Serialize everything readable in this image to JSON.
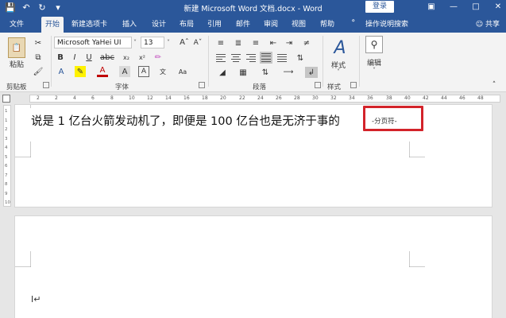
{
  "titlebar": {
    "title": "新建 Microsoft Word 文档.docx - Word",
    "login_label": "登录",
    "qat_icons": [
      "save-icon",
      "undo-icon",
      "redo-icon",
      "customize-icon"
    ],
    "window_buttons": [
      "ribbon-display-icon",
      "minimize-icon",
      "maximize-icon",
      "close-icon"
    ]
  },
  "tabs": [
    {
      "label": "文件"
    },
    {
      "label": "开始",
      "active": true
    },
    {
      "label": "新建选项卡"
    },
    {
      "label": "插入"
    },
    {
      "label": "设计"
    },
    {
      "label": "布局"
    },
    {
      "label": "引用"
    },
    {
      "label": "邮件"
    },
    {
      "label": "审阅"
    },
    {
      "label": "视图"
    },
    {
      "label": "帮助"
    }
  ],
  "tell_me": "操作说明搜索",
  "share": "共享",
  "ribbon": {
    "clipboard": {
      "paste_label": "粘贴",
      "group_label": "剪贴板"
    },
    "font": {
      "font_name": "Microsoft YaHei UI",
      "font_size": "13",
      "group_label": "字体"
    },
    "paragraph": {
      "group_label": "段落"
    },
    "styles": {
      "button_label": "样式",
      "group_label": "样式"
    },
    "editing": {
      "button_label": "编辑"
    }
  },
  "ruler": {
    "numbers": [
      "2",
      "2",
      "4",
      "6",
      "8",
      "10",
      "12",
      "14",
      "16",
      "18",
      "20",
      "22",
      "24",
      "26",
      "28",
      "30",
      "32",
      "34",
      "36",
      "38",
      "40",
      "42",
      "44",
      "46",
      "48"
    ],
    "vertical_numbers": [
      "1",
      "1",
      "2",
      "3",
      "4",
      "5",
      "6",
      "7",
      "8",
      "9",
      "10"
    ]
  },
  "document": {
    "text": "说是 1 亿台火箭发动机了，即便是 100 亿台也是无济于事的",
    "page_break_label": "-分页符-"
  },
  "colors": {
    "accent": "#2b579a",
    "highlight_box": "#d3232a"
  }
}
